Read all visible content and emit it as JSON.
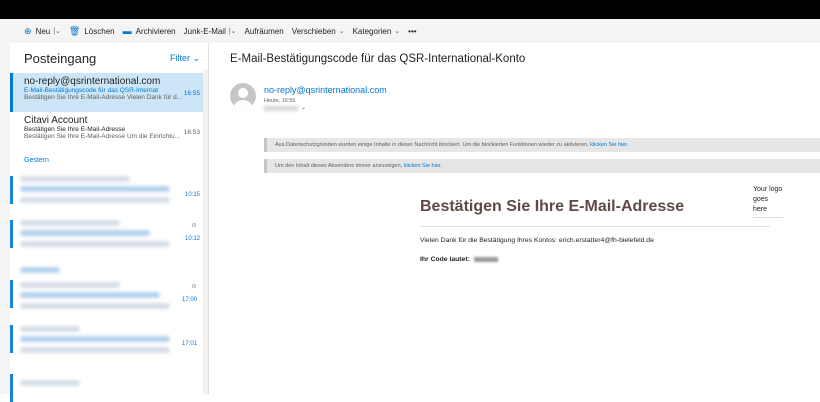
{
  "toolbar": {
    "new_label": "Neu",
    "delete_label": "Löschen",
    "archive_label": "Archivieren",
    "junk_label": "Junk-E-Mail",
    "sweep_label": "Aufräumen",
    "move_label": "Verschieben",
    "categories_label": "Kategorien",
    "more_label": "•••"
  },
  "mail_list": {
    "title": "Posteingang",
    "filter_label": "Filter",
    "items": [
      {
        "from": "no-reply@qsrinternational.com",
        "subject": "E-Mail-Bestätigungscode für das QSR-Internat",
        "time": "16:55",
        "preview": "Bestätigen Sie Ihre E-Mail-Adresse  Vielen Dank für d..."
      },
      {
        "from": "Citavi Account",
        "subject": "Bestätigen Sie Ihre E-Mail-Adresse",
        "time": "16:53",
        "preview": "Bestätigen Sie Ihre E-Mail-Adresse   Um die Einrichtu..."
      }
    ],
    "group_label": "Gestern",
    "hidden_times": [
      "10:15",
      "10:12",
      "17:00",
      "17:01"
    ]
  },
  "reading": {
    "subject": "E-Mail-Bestätigungscode für das QSR-International-Konto",
    "sender": "no-reply@qsrinternational.com",
    "date": "Heute, 16:55",
    "notice1_text": "Aus Datenschutzgründen wurden einige Inhalte in dieser Nachricht blockiert. Um die blockierten Funktionen wieder zu aktivieren,",
    "notice1_link": "klicken Sie hier.",
    "notice2_text": "Um den Inhalt dieses Absenders immer anzuzeigen,",
    "notice2_link": "klicken Sie hier.",
    "logo_placeholder": "Your logo goes here",
    "headline": "Bestätigen Sie Ihre E-Mail-Adresse",
    "thanks_text": "Vielen Dank für die Bestätigung Ihres Kontos: erich.erstatter4@fh-bielefeld.de",
    "code_label": "Ihr Code lautet:"
  },
  "colors": {
    "accent": "#0078d4",
    "selected_bg": "#cde6f7",
    "headline": "#5e4a46"
  }
}
